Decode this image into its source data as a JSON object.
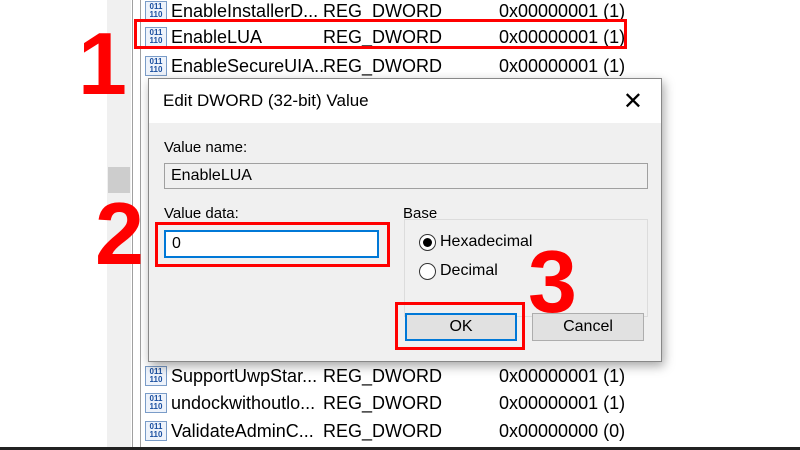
{
  "registry_rows_top": [
    {
      "name": "EnableInstallerD...",
      "type": "REG_DWORD",
      "data": "0x00000001 (1)"
    },
    {
      "name": "EnableLUA",
      "type": "REG_DWORD",
      "data": "0x00000001 (1)"
    },
    {
      "name": "EnableSecureUIA...",
      "type": "REG_DWORD",
      "data": "0x00000001 (1)"
    }
  ],
  "registry_rows_bottom": [
    {
      "name": "SupportUwpStar...",
      "type": "REG_DWORD",
      "data": "0x00000001 (1)"
    },
    {
      "name": "undockwithoutlo...",
      "type": "REG_DWORD",
      "data": "0x00000001 (1)"
    },
    {
      "name": "ValidateAdminC...",
      "type": "REG_DWORD",
      "data": "0x00000000 (0)"
    }
  ],
  "reg_icon_text": "011\n110",
  "dialog": {
    "title": "Edit DWORD (32-bit) Value",
    "close": "✕",
    "value_name_label": "Value name:",
    "value_name": "EnableLUA",
    "value_data_label": "Value data:",
    "value_data": "0",
    "base_label": "Base",
    "hex_label": "Hexadecimal",
    "dec_label": "Decimal",
    "base_selected": "Hexadecimal",
    "ok": "OK",
    "cancel": "Cancel"
  },
  "steps": [
    "1",
    "2",
    "3"
  ],
  "highlight_color": "#ff0000"
}
